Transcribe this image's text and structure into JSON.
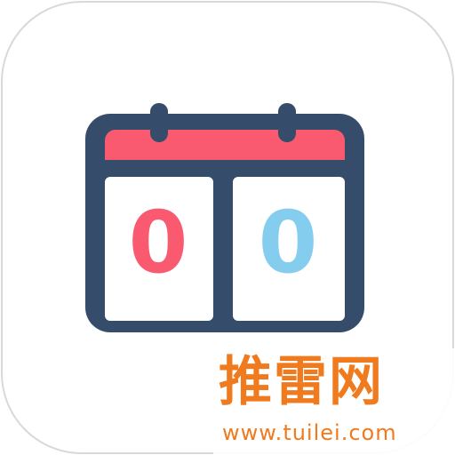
{
  "icon": {
    "name": "scoreboard-calendar-icon",
    "colors": {
      "frame": "#354d6b",
      "header": "#fa5a6f",
      "left_digit": "#fa5a6f",
      "right_digit": "#85cdee",
      "card": "#ffffff",
      "border": "#d9d9d9"
    },
    "left_score": "0",
    "right_score": "0"
  },
  "watermark": {
    "title": "推雷网",
    "url": "www.tuilei.com",
    "title_color": "#f07a1e",
    "url_color": "#f07a1e"
  }
}
